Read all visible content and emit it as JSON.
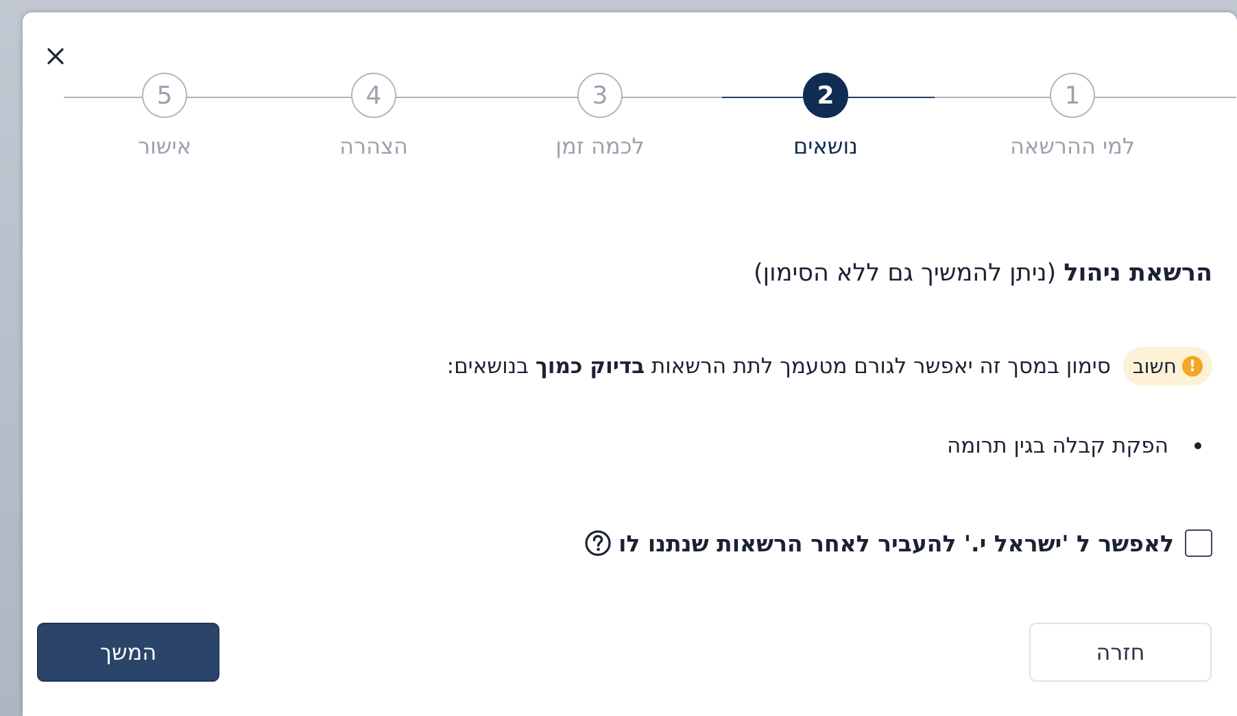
{
  "dialog": {
    "close_label": "×"
  },
  "stepper": {
    "current_step": 2,
    "steps": [
      {
        "number": "1",
        "label": "למי ההרשאה",
        "state": "done"
      },
      {
        "number": "2",
        "label": "נושאים",
        "state": "active"
      },
      {
        "number": "3",
        "label": "לכמה זמן",
        "state": "upcoming"
      },
      {
        "number": "4",
        "label": "הצהרה",
        "state": "upcoming"
      },
      {
        "number": "5",
        "label": "אישור",
        "state": "upcoming"
      }
    ]
  },
  "section": {
    "title": "הרשאת ניהול",
    "title_note": "(ניתן להמשיך גם ללא הסימון)"
  },
  "important": {
    "badge_label": "חשוב",
    "badge_icon": "warning-icon",
    "text_before": "סימון במסך זה יאפשר לגורם מטעמך לתת הרשאות ",
    "text_bold": "בדיוק כמוך",
    "text_after": " בנושאים:"
  },
  "topics": [
    "הפקת קבלה בגין תרומה"
  ],
  "delegate_checkbox": {
    "label": "לאפשר ל 'ישראל י.' להעביר לאחר הרשאות שנתנו לו",
    "checked": false,
    "help_icon": "question-circle-icon"
  },
  "footer": {
    "continue_label": "המשך",
    "back_label": "חזרה"
  },
  "colors": {
    "primary": "#2a4569",
    "active_step": "#102c52",
    "inactive_step": "#9aa2ae",
    "badge_bg": "#fdf1d6",
    "warning": "#f5a623"
  }
}
